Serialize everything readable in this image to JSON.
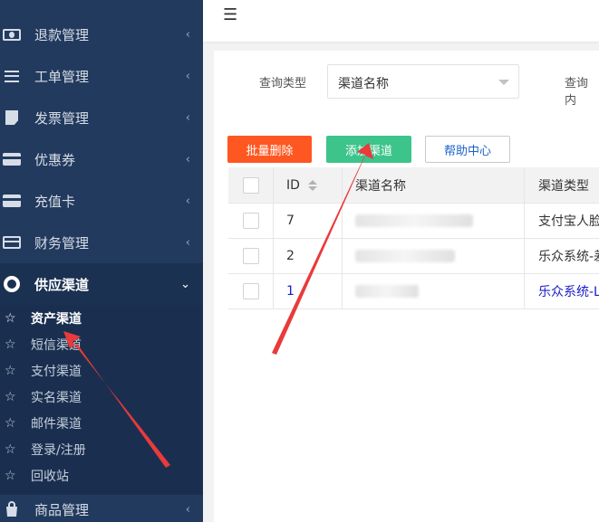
{
  "sidebar": {
    "menus": [
      {
        "label": "退款管理",
        "icon": "money-icon",
        "chevron": "‹"
      },
      {
        "label": "工单管理",
        "icon": "list-icon",
        "chevron": "‹"
      },
      {
        "label": "发票管理",
        "icon": "note-icon",
        "chevron": "‹"
      },
      {
        "label": "优惠券",
        "icon": "card-icon",
        "chevron": "‹"
      },
      {
        "label": "充值卡",
        "icon": "card-icon",
        "chevron": "‹"
      },
      {
        "label": "财务管理",
        "icon": "card-outline-icon",
        "chevron": "‹"
      },
      {
        "label": "供应渠道",
        "icon": "lifebuoy-icon",
        "chevron": "⌄"
      }
    ],
    "submenu": [
      {
        "label": "资产渠道"
      },
      {
        "label": "短信渠道"
      },
      {
        "label": "支付渠道"
      },
      {
        "label": "实名渠道"
      },
      {
        "label": "邮件渠道"
      },
      {
        "label": "登录/注册"
      },
      {
        "label": "回收站"
      }
    ],
    "bottom_menu": {
      "label": "商品管理",
      "chevron": "‹"
    },
    "star": "☆"
  },
  "topbar": {
    "menu_icon": "☰"
  },
  "filter": {
    "type_label": "查询类型",
    "type_value": "渠道名称",
    "content_label": "查询内"
  },
  "toolbar": {
    "batch_delete": "批量删除",
    "add_channel": "添加渠道",
    "help_center": "帮助中心"
  },
  "table": {
    "headers": {
      "id": "ID",
      "name": "渠道名称",
      "type": "渠道类型"
    },
    "rows": [
      {
        "id": "7",
        "name": "",
        "type": "支付宝人脸"
      },
      {
        "id": "2",
        "name": "",
        "type": "乐众系统-差"
      },
      {
        "id": "1",
        "name": "",
        "type": "乐众系统-L"
      }
    ]
  },
  "colors": {
    "sidebar_bg": "#223a5e",
    "danger": "#ff5722",
    "success": "#3cc48b",
    "link": "#1e61c9",
    "annotation_arrow": "#ea3a3a"
  }
}
